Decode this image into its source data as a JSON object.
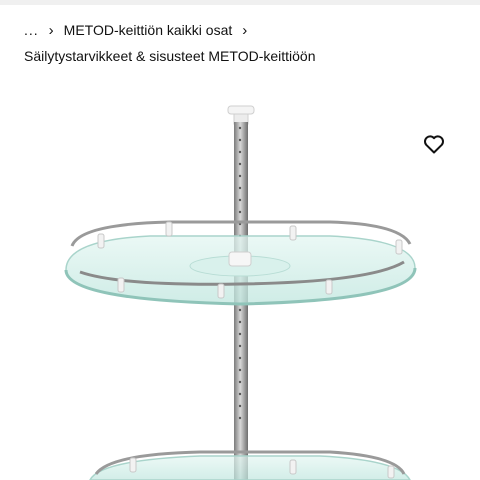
{
  "breadcrumb": {
    "ellipsis": "...",
    "items": [
      {
        "label": "METOD-keittiön kaikki osat"
      }
    ]
  },
  "subcategory": "Säilytystarvikkeet & sisusteet METOD-keittiöön",
  "favorite": {
    "icon": "heart-outline-icon"
  },
  "product_image": {
    "subject": "carousel-shelf"
  },
  "colors": {
    "text": "#111111",
    "topbar": "#f0f0f0",
    "glass": "#cfeee8",
    "steel": "#9a9a9a"
  }
}
